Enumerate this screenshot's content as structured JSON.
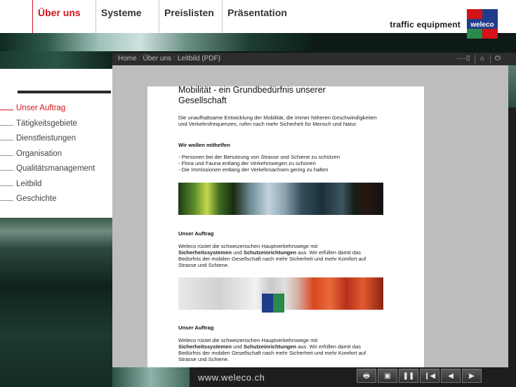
{
  "nav": {
    "items": [
      {
        "label": "Über uns",
        "active": true
      },
      {
        "label": "Systeme"
      },
      {
        "label": "Preislisten"
      },
      {
        "label": "Präsentation"
      }
    ]
  },
  "brand": {
    "tagline": "traffic equipment",
    "logo_text": "weleco",
    "colors": {
      "red": "#d4121a",
      "blue": "#1f3d8a",
      "green": "#2a8a4a"
    }
  },
  "sidebar": {
    "items": [
      {
        "label": "Unser Auftrag",
        "active": true
      },
      {
        "label": "Tätigkeitsgebiete"
      },
      {
        "label": "Dienstleistungen"
      },
      {
        "label": "Organisation"
      },
      {
        "label": "Qualitätsmanagement"
      },
      {
        "label": "Leitbild"
      },
      {
        "label": "Geschichte"
      }
    ]
  },
  "window": {
    "breadcrumb": [
      "Home",
      "Über uns",
      "Leitbild (PDF)"
    ],
    "icons": [
      "zoom-icon",
      "home-icon",
      "power-icon"
    ]
  },
  "doc": {
    "title_line1": "Mobilität - ein Grundbedürfnis unserer",
    "title_line2": "Gesellschaft",
    "intro_line1": "Die unaufhaltsame Entwicklung der Mobilität, die immer höheren Geschwindigkeiten",
    "intro_line2": "und Verkehrsfrequenzen, rufen nach mehr Sicherheit für Mensch und Natur.",
    "heading_help": "Wir wollen mithelfen",
    "bullets": [
      "- Personen bei der Benutzung von Strasse und Schiene zu schützen",
      "- Flora und Fauna entlang der Verkehrswegen zu schonen",
      "- Die Immissionen entlang der Verkehrsachsen gering zu halten"
    ],
    "section1": {
      "heading": "Unser Auftrag",
      "l1": "Weleco rüstet die schweizerischen Hauptverkehrswege mit",
      "l2a": "Sicherheitssystemen",
      "l2b": " und ",
      "l2c": "Schutzeinrichtungen",
      "l2d": " aus. Wir erfüllen damit das",
      "l3": "Bedürfnis der mobilen Gesellschaft nach mehr Sicherheit und mehr Komfort auf",
      "l4": "Strasse und Schiene."
    },
    "section2": {
      "heading": "Unser Auftrag",
      "l1": "Weleco rüstet die schweizerischen Hauptverkehrswege mit",
      "l2a": "Sicherheitssystemen",
      "l2b": " und ",
      "l2c": "Schutzeinrichtungen",
      "l2d": " aus. Wir erfüllen damit das",
      "l3": "Bedürfnis der mobilen Gesellschaft nach mehr Sicherheit und mehr Komfort auf",
      "l4": "Strasse und Schiene."
    }
  },
  "footer": {
    "url": "www.weleco.ch",
    "controls": [
      "print-icon",
      "save-icon",
      "pause-icon",
      "step-back-icon",
      "prev-icon",
      "next-icon"
    ]
  }
}
